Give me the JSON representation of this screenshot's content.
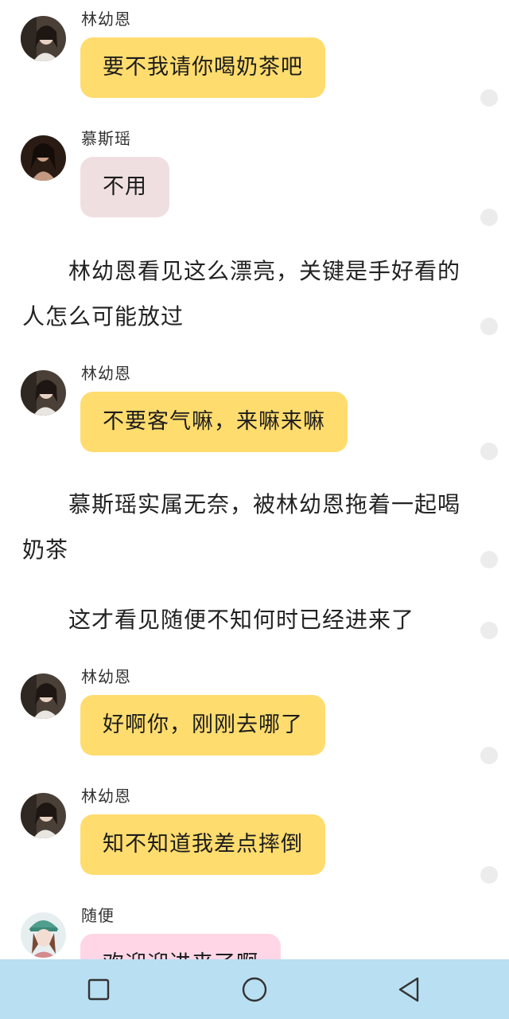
{
  "messages": [
    {
      "sender": "林幼恩",
      "text": "要不我请你喝奶茶吧"
    },
    {
      "sender": "慕斯瑶",
      "text": "不用"
    },
    {
      "sender": "林幼恩",
      "text": "不要客气嘛，来嘛来嘛"
    },
    {
      "sender": "林幼恩",
      "text": "好啊你，刚刚去哪了"
    },
    {
      "sender": "林幼恩",
      "text": "知不知道我差点摔倒"
    },
    {
      "sender": "随便",
      "text": "欢迎迎进来了啊"
    }
  ],
  "narrations": [
    "林幼恩看见这么漂亮，关键是手好看的人怎么可能放过",
    "慕斯瑶实属无奈，被林幼恩拖着一起喝奶茶",
    "这才看见随便不知何时已经进来了"
  ],
  "colors": {
    "bubble_yellow": "#ffdc6e",
    "bubble_pink": "#f0dfe1",
    "bubble_rose": "#ffd6e6",
    "navbar": "#b9dff2"
  },
  "navbar": {
    "icons": [
      "recent-apps-icon",
      "home-icon",
      "back-icon"
    ]
  }
}
